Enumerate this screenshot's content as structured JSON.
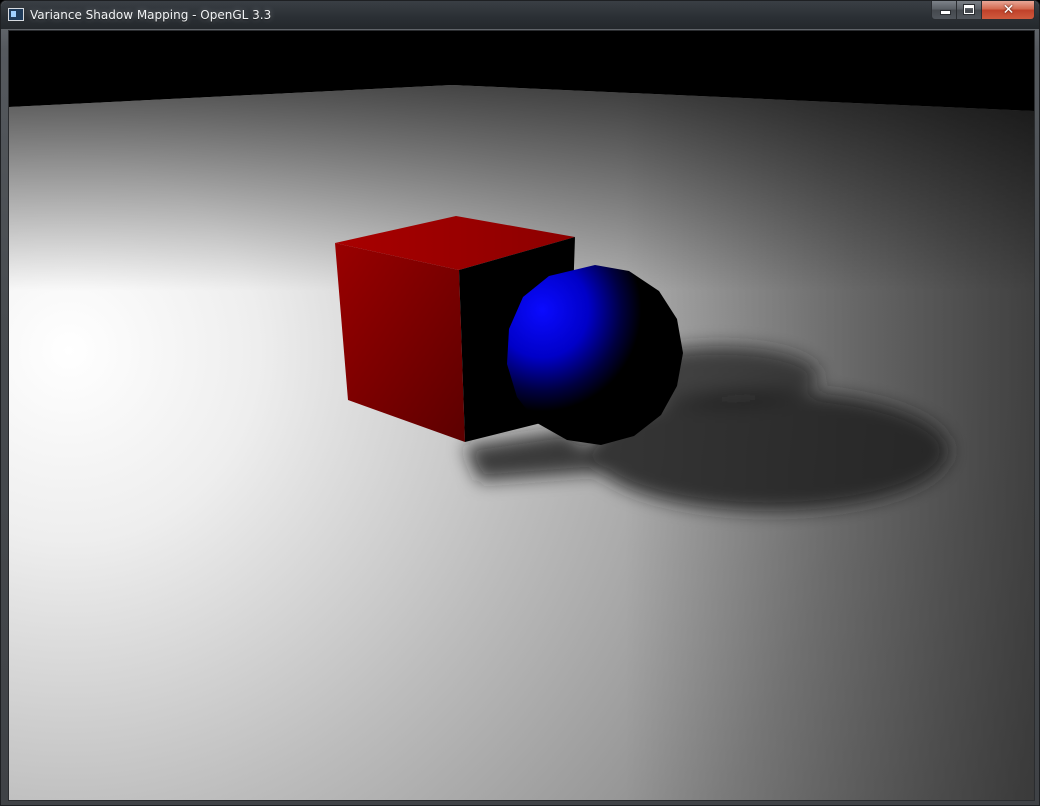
{
  "window": {
    "title": "Variance Shadow Mapping - OpenGL 3.3",
    "icon": "app-window-icon",
    "caption_buttons": {
      "minimize": "minimize-icon",
      "maximize": "maximize-icon",
      "close": "close-icon",
      "close_glyph": "✕"
    }
  },
  "scene": {
    "background_color": "#000000",
    "objects": [
      {
        "name": "cube",
        "color": "#a00000"
      },
      {
        "name": "sphere",
        "color": "#0000ff"
      },
      {
        "name": "ground-plane",
        "color": "#ffffff"
      }
    ]
  }
}
